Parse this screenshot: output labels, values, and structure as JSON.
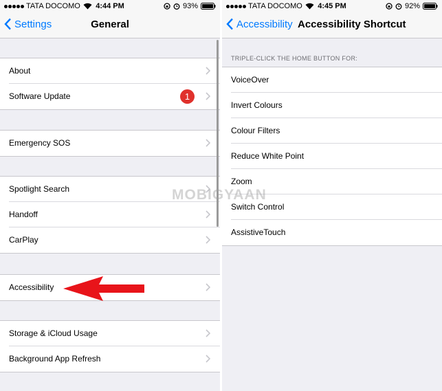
{
  "left": {
    "status": {
      "carrier": "TATA DOCOMO",
      "time": "4:44 PM",
      "battery": "93%"
    },
    "nav": {
      "back": "Settings",
      "title": "General"
    },
    "groups": [
      [
        {
          "label": "About"
        },
        {
          "label": "Software Update",
          "badge": "1"
        }
      ],
      [
        {
          "label": "Emergency SOS"
        }
      ],
      [
        {
          "label": "Spotlight Search"
        },
        {
          "label": "Handoff"
        },
        {
          "label": "CarPlay"
        }
      ],
      [
        {
          "label": "Accessibility"
        }
      ],
      [
        {
          "label": "Storage & iCloud Usage"
        },
        {
          "label": "Background App Refresh"
        }
      ]
    ]
  },
  "right": {
    "status": {
      "carrier": "TATA DOCOMO",
      "time": "4:45 PM",
      "battery": "92%"
    },
    "nav": {
      "back": "Accessibility",
      "title": "Accessibility Shortcut"
    },
    "section_header": "TRIPLE-CLICK THE HOME BUTTON FOR:",
    "options": [
      {
        "label": "VoiceOver"
      },
      {
        "label": "Invert Colours"
      },
      {
        "label": "Colour Filters"
      },
      {
        "label": "Reduce White Point"
      },
      {
        "label": "Zoom"
      },
      {
        "label": "Switch Control"
      },
      {
        "label": "AssistiveTouch"
      }
    ]
  },
  "watermark": "MOBIGYAAN",
  "colors": {
    "ios_blue": "#007aff",
    "badge_red": "#e0312c",
    "arrow_red": "#e8141a",
    "background": "#efeff4"
  }
}
